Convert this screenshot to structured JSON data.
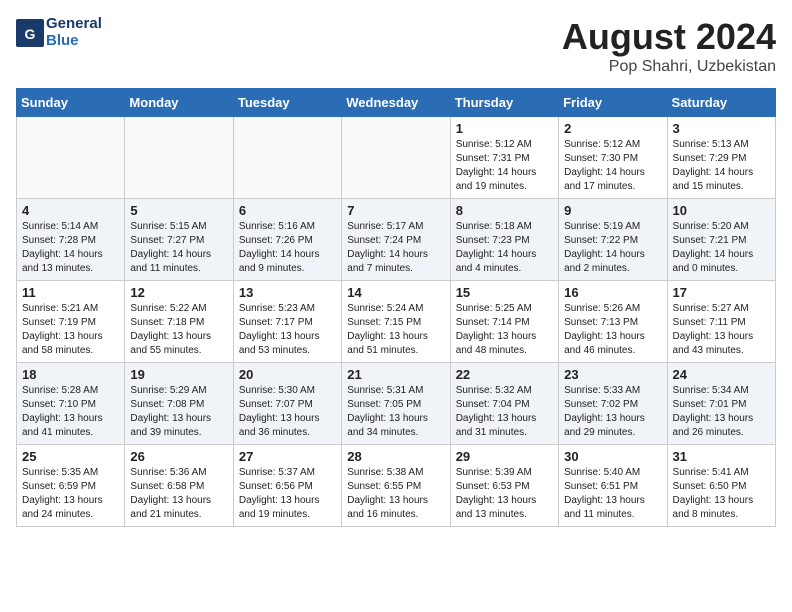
{
  "header": {
    "logo_line1": "General",
    "logo_line2": "Blue",
    "month_year": "August 2024",
    "location": "Pop Shahri, Uzbekistan"
  },
  "weekdays": [
    "Sunday",
    "Monday",
    "Tuesday",
    "Wednesday",
    "Thursday",
    "Friday",
    "Saturday"
  ],
  "weeks": [
    [
      {
        "day": "",
        "info": ""
      },
      {
        "day": "",
        "info": ""
      },
      {
        "day": "",
        "info": ""
      },
      {
        "day": "",
        "info": ""
      },
      {
        "day": "1",
        "info": "Sunrise: 5:12 AM\nSunset: 7:31 PM\nDaylight: 14 hours\nand 19 minutes."
      },
      {
        "day": "2",
        "info": "Sunrise: 5:12 AM\nSunset: 7:30 PM\nDaylight: 14 hours\nand 17 minutes."
      },
      {
        "day": "3",
        "info": "Sunrise: 5:13 AM\nSunset: 7:29 PM\nDaylight: 14 hours\nand 15 minutes."
      }
    ],
    [
      {
        "day": "4",
        "info": "Sunrise: 5:14 AM\nSunset: 7:28 PM\nDaylight: 14 hours\nand 13 minutes."
      },
      {
        "day": "5",
        "info": "Sunrise: 5:15 AM\nSunset: 7:27 PM\nDaylight: 14 hours\nand 11 minutes."
      },
      {
        "day": "6",
        "info": "Sunrise: 5:16 AM\nSunset: 7:26 PM\nDaylight: 14 hours\nand 9 minutes."
      },
      {
        "day": "7",
        "info": "Sunrise: 5:17 AM\nSunset: 7:24 PM\nDaylight: 14 hours\nand 7 minutes."
      },
      {
        "day": "8",
        "info": "Sunrise: 5:18 AM\nSunset: 7:23 PM\nDaylight: 14 hours\nand 4 minutes."
      },
      {
        "day": "9",
        "info": "Sunrise: 5:19 AM\nSunset: 7:22 PM\nDaylight: 14 hours\nand 2 minutes."
      },
      {
        "day": "10",
        "info": "Sunrise: 5:20 AM\nSunset: 7:21 PM\nDaylight: 14 hours\nand 0 minutes."
      }
    ],
    [
      {
        "day": "11",
        "info": "Sunrise: 5:21 AM\nSunset: 7:19 PM\nDaylight: 13 hours\nand 58 minutes."
      },
      {
        "day": "12",
        "info": "Sunrise: 5:22 AM\nSunset: 7:18 PM\nDaylight: 13 hours\nand 55 minutes."
      },
      {
        "day": "13",
        "info": "Sunrise: 5:23 AM\nSunset: 7:17 PM\nDaylight: 13 hours\nand 53 minutes."
      },
      {
        "day": "14",
        "info": "Sunrise: 5:24 AM\nSunset: 7:15 PM\nDaylight: 13 hours\nand 51 minutes."
      },
      {
        "day": "15",
        "info": "Sunrise: 5:25 AM\nSunset: 7:14 PM\nDaylight: 13 hours\nand 48 minutes."
      },
      {
        "day": "16",
        "info": "Sunrise: 5:26 AM\nSunset: 7:13 PM\nDaylight: 13 hours\nand 46 minutes."
      },
      {
        "day": "17",
        "info": "Sunrise: 5:27 AM\nSunset: 7:11 PM\nDaylight: 13 hours\nand 43 minutes."
      }
    ],
    [
      {
        "day": "18",
        "info": "Sunrise: 5:28 AM\nSunset: 7:10 PM\nDaylight: 13 hours\nand 41 minutes."
      },
      {
        "day": "19",
        "info": "Sunrise: 5:29 AM\nSunset: 7:08 PM\nDaylight: 13 hours\nand 39 minutes."
      },
      {
        "day": "20",
        "info": "Sunrise: 5:30 AM\nSunset: 7:07 PM\nDaylight: 13 hours\nand 36 minutes."
      },
      {
        "day": "21",
        "info": "Sunrise: 5:31 AM\nSunset: 7:05 PM\nDaylight: 13 hours\nand 34 minutes."
      },
      {
        "day": "22",
        "info": "Sunrise: 5:32 AM\nSunset: 7:04 PM\nDaylight: 13 hours\nand 31 minutes."
      },
      {
        "day": "23",
        "info": "Sunrise: 5:33 AM\nSunset: 7:02 PM\nDaylight: 13 hours\nand 29 minutes."
      },
      {
        "day": "24",
        "info": "Sunrise: 5:34 AM\nSunset: 7:01 PM\nDaylight: 13 hours\nand 26 minutes."
      }
    ],
    [
      {
        "day": "25",
        "info": "Sunrise: 5:35 AM\nSunset: 6:59 PM\nDaylight: 13 hours\nand 24 minutes."
      },
      {
        "day": "26",
        "info": "Sunrise: 5:36 AM\nSunset: 6:58 PM\nDaylight: 13 hours\nand 21 minutes."
      },
      {
        "day": "27",
        "info": "Sunrise: 5:37 AM\nSunset: 6:56 PM\nDaylight: 13 hours\nand 19 minutes."
      },
      {
        "day": "28",
        "info": "Sunrise: 5:38 AM\nSunset: 6:55 PM\nDaylight: 13 hours\nand 16 minutes."
      },
      {
        "day": "29",
        "info": "Sunrise: 5:39 AM\nSunset: 6:53 PM\nDaylight: 13 hours\nand 13 minutes."
      },
      {
        "day": "30",
        "info": "Sunrise: 5:40 AM\nSunset: 6:51 PM\nDaylight: 13 hours\nand 11 minutes."
      },
      {
        "day": "31",
        "info": "Sunrise: 5:41 AM\nSunset: 6:50 PM\nDaylight: 13 hours\nand 8 minutes."
      }
    ]
  ]
}
